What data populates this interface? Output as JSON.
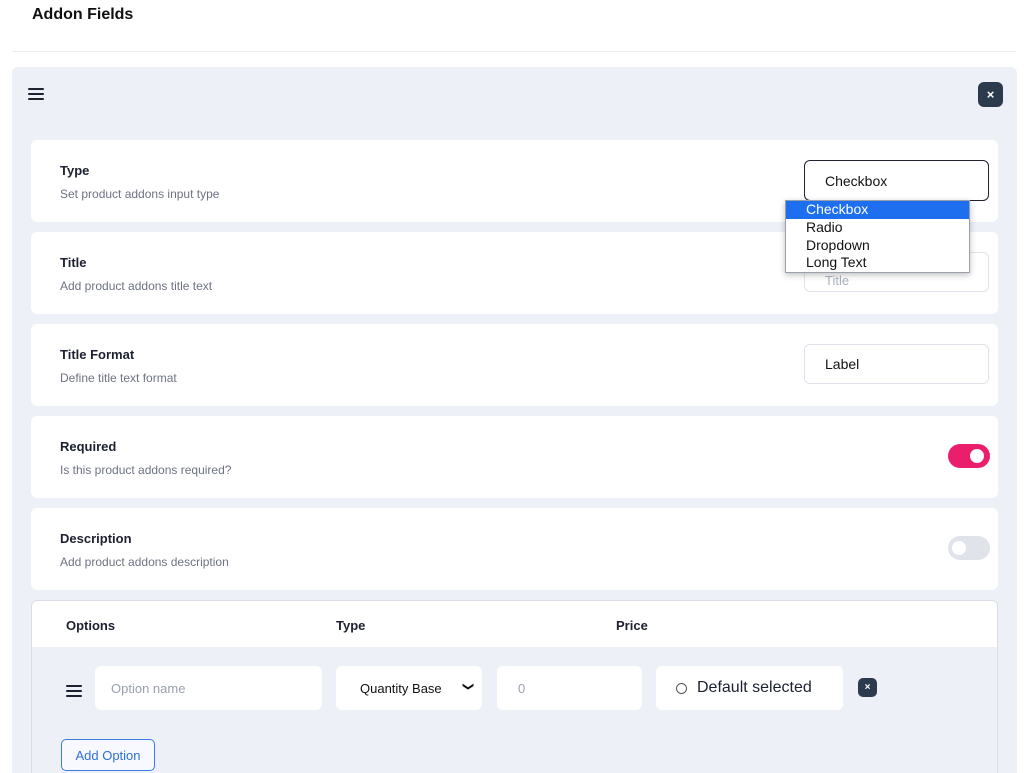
{
  "page": {
    "title": "Addon Fields"
  },
  "panel": {
    "close_glyph": "×",
    "menu_icon": "hamburger-icon"
  },
  "fields": {
    "type": {
      "label": "Type",
      "description": "Set product addons input type",
      "value": "Checkbox"
    },
    "title": {
      "label": "Title",
      "description": "Add product addons title text",
      "placeholder": "Title"
    },
    "title_format": {
      "label": "Title Format",
      "description": "Define title text format",
      "value": "Label"
    },
    "required": {
      "label": "Required",
      "description": "Is this product addons required?",
      "enabled": true
    },
    "description": {
      "label": "Description",
      "description": "Add product addons description",
      "enabled": false
    }
  },
  "type_dropdown": {
    "options": [
      "Checkbox",
      "Radio",
      "Dropdown",
      "Long Text"
    ],
    "selected": "Checkbox"
  },
  "options_table": {
    "headers": {
      "options": "Options",
      "type": "Type",
      "price": "Price"
    },
    "row": {
      "name_placeholder": "Option name",
      "type_value": "Quantity Base",
      "price_placeholder": "0",
      "default_label": "Default selected",
      "remove_glyph": "×"
    },
    "add_button": "Add Option"
  },
  "colors": {
    "toggle_on": "#ea1e6b",
    "toggle_off": "#e1e3ea",
    "accent_blue": "#1e6ff0",
    "close_button": "#2c3a4e"
  }
}
